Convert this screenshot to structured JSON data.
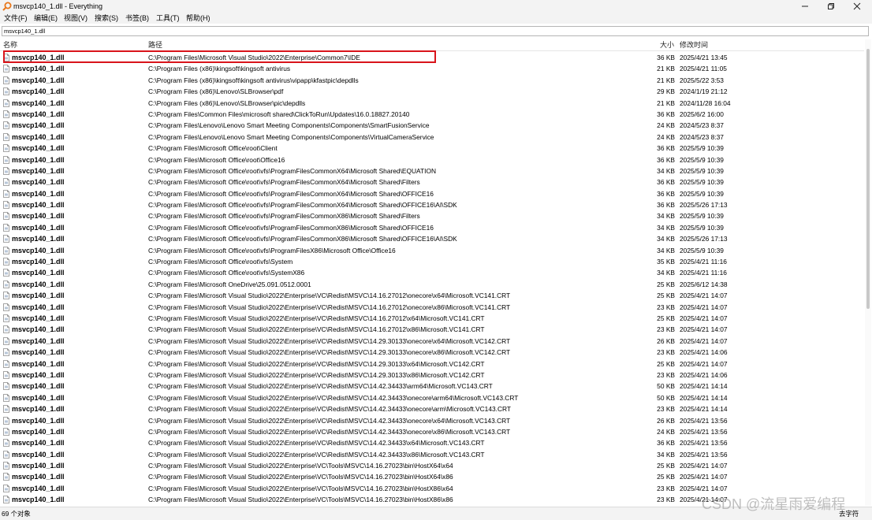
{
  "window": {
    "title": "msvcp140_1.dll - Everything"
  },
  "menu": [
    "文件(F)",
    "编辑(E)",
    "视图(V)",
    "搜索(S)",
    "书签(B)",
    "工具(T)",
    "帮助(H)"
  ],
  "search": {
    "value": "msvcp140_1.dll"
  },
  "columns": {
    "name": "名称",
    "path": "路径",
    "size": "大小",
    "modified": "修改时间"
  },
  "rows": [
    {
      "name": "msvcp140_1.dll",
      "path": "C:\\Program Files\\Microsoft Visual Studio\\2022\\Enterprise\\Common7\\IDE",
      "size": "36 KB",
      "modified": "2025/4/21 13:45"
    },
    {
      "name": "msvcp140_1.dll",
      "path": "C:\\Program Files (x86)\\kingsoft\\kingsoft antivirus",
      "size": "21 KB",
      "modified": "2025/4/21 11:05"
    },
    {
      "name": "msvcp140_1.dll",
      "path": "C:\\Program Files (x86)\\kingsoft\\kingsoft antivirus\\vipapp\\kfastpic\\depdlls",
      "size": "21 KB",
      "modified": "2025/5/22 3:53"
    },
    {
      "name": "msvcp140_1.dll",
      "path": "C:\\Program Files (x86)\\Lenovo\\SLBrowser\\pdf",
      "size": "29 KB",
      "modified": "2024/1/19 21:12"
    },
    {
      "name": "msvcp140_1.dll",
      "path": "C:\\Program Files (x86)\\Lenovo\\SLBrowser\\pic\\depdlls",
      "size": "21 KB",
      "modified": "2024/11/28 16:04"
    },
    {
      "name": "msvcp140_1.dll",
      "path": "C:\\Program Files\\Common Files\\microsoft shared\\ClickToRun\\Updates\\16.0.18827.20140",
      "size": "36 KB",
      "modified": "2025/6/2 16:00"
    },
    {
      "name": "msvcp140_1.dll",
      "path": "C:\\Program Files\\Lenovo\\Lenovo Smart Meeting Components\\Components\\SmartFusionService",
      "size": "24 KB",
      "modified": "2024/5/23 8:37"
    },
    {
      "name": "msvcp140_1.dll",
      "path": "C:\\Program Files\\Lenovo\\Lenovo Smart Meeting Components\\Components\\VirtualCameraService",
      "size": "24 KB",
      "modified": "2024/5/23 8:37"
    },
    {
      "name": "msvcp140_1.dll",
      "path": "C:\\Program Files\\Microsoft Office\\root\\Client",
      "size": "36 KB",
      "modified": "2025/5/9 10:39"
    },
    {
      "name": "msvcp140_1.dll",
      "path": "C:\\Program Files\\Microsoft Office\\root\\Office16",
      "size": "36 KB",
      "modified": "2025/5/9 10:39"
    },
    {
      "name": "msvcp140_1.dll",
      "path": "C:\\Program Files\\Microsoft Office\\root\\vfs\\ProgramFilesCommonX64\\Microsoft Shared\\EQUATION",
      "size": "34 KB",
      "modified": "2025/5/9 10:39"
    },
    {
      "name": "msvcp140_1.dll",
      "path": "C:\\Program Files\\Microsoft Office\\root\\vfs\\ProgramFilesCommonX64\\Microsoft Shared\\Filters",
      "size": "36 KB",
      "modified": "2025/5/9 10:39"
    },
    {
      "name": "msvcp140_1.dll",
      "path": "C:\\Program Files\\Microsoft Office\\root\\vfs\\ProgramFilesCommonX64\\Microsoft Shared\\OFFICE16",
      "size": "36 KB",
      "modified": "2025/5/9 10:39"
    },
    {
      "name": "msvcp140_1.dll",
      "path": "C:\\Program Files\\Microsoft Office\\root\\vfs\\ProgramFilesCommonX64\\Microsoft Shared\\OFFICE16\\AI\\SDK",
      "size": "36 KB",
      "modified": "2025/5/26 17:13"
    },
    {
      "name": "msvcp140_1.dll",
      "path": "C:\\Program Files\\Microsoft Office\\root\\vfs\\ProgramFilesCommonX86\\Microsoft Shared\\Filters",
      "size": "34 KB",
      "modified": "2025/5/9 10:39"
    },
    {
      "name": "msvcp140_1.dll",
      "path": "C:\\Program Files\\Microsoft Office\\root\\vfs\\ProgramFilesCommonX86\\Microsoft Shared\\OFFICE16",
      "size": "34 KB",
      "modified": "2025/5/9 10:39"
    },
    {
      "name": "msvcp140_1.dll",
      "path": "C:\\Program Files\\Microsoft Office\\root\\vfs\\ProgramFilesCommonX86\\Microsoft Shared\\OFFICE16\\AI\\SDK",
      "size": "34 KB",
      "modified": "2025/5/26 17:13"
    },
    {
      "name": "msvcp140_1.dll",
      "path": "C:\\Program Files\\Microsoft Office\\root\\vfs\\ProgramFilesX86\\Microsoft Office\\Office16",
      "size": "34 KB",
      "modified": "2025/5/9 10:39"
    },
    {
      "name": "msvcp140_1.dll",
      "path": "C:\\Program Files\\Microsoft Office\\root\\vfs\\System",
      "size": "35 KB",
      "modified": "2025/4/21 11:16"
    },
    {
      "name": "msvcp140_1.dll",
      "path": "C:\\Program Files\\Microsoft Office\\root\\vfs\\SystemX86",
      "size": "34 KB",
      "modified": "2025/4/21 11:16"
    },
    {
      "name": "msvcp140_1.dll",
      "path": "C:\\Program Files\\Microsoft OneDrive\\25.091.0512.0001",
      "size": "25 KB",
      "modified": "2025/6/12 14:38"
    },
    {
      "name": "msvcp140_1.dll",
      "path": "C:\\Program Files\\Microsoft Visual Studio\\2022\\Enterprise\\VC\\Redist\\MSVC\\14.16.27012\\onecore\\x64\\Microsoft.VC141.CRT",
      "size": "25 KB",
      "modified": "2025/4/21 14:07"
    },
    {
      "name": "msvcp140_1.dll",
      "path": "C:\\Program Files\\Microsoft Visual Studio\\2022\\Enterprise\\VC\\Redist\\MSVC\\14.16.27012\\onecore\\x86\\Microsoft.VC141.CRT",
      "size": "23 KB",
      "modified": "2025/4/21 14:07"
    },
    {
      "name": "msvcp140_1.dll",
      "path": "C:\\Program Files\\Microsoft Visual Studio\\2022\\Enterprise\\VC\\Redist\\MSVC\\14.16.27012\\x64\\Microsoft.VC141.CRT",
      "size": "25 KB",
      "modified": "2025/4/21 14:07"
    },
    {
      "name": "msvcp140_1.dll",
      "path": "C:\\Program Files\\Microsoft Visual Studio\\2022\\Enterprise\\VC\\Redist\\MSVC\\14.16.27012\\x86\\Microsoft.VC141.CRT",
      "size": "23 KB",
      "modified": "2025/4/21 14:07"
    },
    {
      "name": "msvcp140_1.dll",
      "path": "C:\\Program Files\\Microsoft Visual Studio\\2022\\Enterprise\\VC\\Redist\\MSVC\\14.29.30133\\onecore\\x64\\Microsoft.VC142.CRT",
      "size": "26 KB",
      "modified": "2025/4/21 14:07"
    },
    {
      "name": "msvcp140_1.dll",
      "path": "C:\\Program Files\\Microsoft Visual Studio\\2022\\Enterprise\\VC\\Redist\\MSVC\\14.29.30133\\onecore\\x86\\Microsoft.VC142.CRT",
      "size": "23 KB",
      "modified": "2025/4/21 14:06"
    },
    {
      "name": "msvcp140_1.dll",
      "path": "C:\\Program Files\\Microsoft Visual Studio\\2022\\Enterprise\\VC\\Redist\\MSVC\\14.29.30133\\x64\\Microsoft.VC142.CRT",
      "size": "25 KB",
      "modified": "2025/4/21 14:07"
    },
    {
      "name": "msvcp140_1.dll",
      "path": "C:\\Program Files\\Microsoft Visual Studio\\2022\\Enterprise\\VC\\Redist\\MSVC\\14.29.30133\\x86\\Microsoft.VC142.CRT",
      "size": "23 KB",
      "modified": "2025/4/21 14:06"
    },
    {
      "name": "msvcp140_1.dll",
      "path": "C:\\Program Files\\Microsoft Visual Studio\\2022\\Enterprise\\VC\\Redist\\MSVC\\14.42.34433\\arm64\\Microsoft.VC143.CRT",
      "size": "50 KB",
      "modified": "2025/4/21 14:14"
    },
    {
      "name": "msvcp140_1.dll",
      "path": "C:\\Program Files\\Microsoft Visual Studio\\2022\\Enterprise\\VC\\Redist\\MSVC\\14.42.34433\\onecore\\arm64\\Microsoft.VC143.CRT",
      "size": "50 KB",
      "modified": "2025/4/21 14:14"
    },
    {
      "name": "msvcp140_1.dll",
      "path": "C:\\Program Files\\Microsoft Visual Studio\\2022\\Enterprise\\VC\\Redist\\MSVC\\14.42.34433\\onecore\\arm\\Microsoft.VC143.CRT",
      "size": "23 KB",
      "modified": "2025/4/21 14:14"
    },
    {
      "name": "msvcp140_1.dll",
      "path": "C:\\Program Files\\Microsoft Visual Studio\\2022\\Enterprise\\VC\\Redist\\MSVC\\14.42.34433\\onecore\\x64\\Microsoft.VC143.CRT",
      "size": "26 KB",
      "modified": "2025/4/21 13:56"
    },
    {
      "name": "msvcp140_1.dll",
      "path": "C:\\Program Files\\Microsoft Visual Studio\\2022\\Enterprise\\VC\\Redist\\MSVC\\14.42.34433\\onecore\\x86\\Microsoft.VC143.CRT",
      "size": "24 KB",
      "modified": "2025/4/21 13:56"
    },
    {
      "name": "msvcp140_1.dll",
      "path": "C:\\Program Files\\Microsoft Visual Studio\\2022\\Enterprise\\VC\\Redist\\MSVC\\14.42.34433\\x64\\Microsoft.VC143.CRT",
      "size": "36 KB",
      "modified": "2025/4/21 13:56"
    },
    {
      "name": "msvcp140_1.dll",
      "path": "C:\\Program Files\\Microsoft Visual Studio\\2022\\Enterprise\\VC\\Redist\\MSVC\\14.42.34433\\x86\\Microsoft.VC143.CRT",
      "size": "34 KB",
      "modified": "2025/4/21 13:56"
    },
    {
      "name": "msvcp140_1.dll",
      "path": "C:\\Program Files\\Microsoft Visual Studio\\2022\\Enterprise\\VC\\Tools\\MSVC\\14.16.27023\\bin\\HostX64\\x64",
      "size": "25 KB",
      "modified": "2025/4/21 14:07"
    },
    {
      "name": "msvcp140_1.dll",
      "path": "C:\\Program Files\\Microsoft Visual Studio\\2022\\Enterprise\\VC\\Tools\\MSVC\\14.16.27023\\bin\\HostX64\\x86",
      "size": "25 KB",
      "modified": "2025/4/21 14:07"
    },
    {
      "name": "msvcp140_1.dll",
      "path": "C:\\Program Files\\Microsoft Visual Studio\\2022\\Enterprise\\VC\\Tools\\MSVC\\14.16.27023\\bin\\HostX86\\x64",
      "size": "23 KB",
      "modified": "2025/4/21 14:07"
    },
    {
      "name": "msvcp140_1.dll",
      "path": "C:\\Program Files\\Microsoft Visual Studio\\2022\\Enterprise\\VC\\Tools\\MSVC\\14.16.27023\\bin\\HostX86\\x86",
      "size": "23 KB",
      "modified": "2025/4/21 14:07"
    }
  ],
  "status": {
    "count": "69 个对象",
    "right": "去字符"
  },
  "watermark": "CSDN @流星雨爱编程",
  "colors": {
    "highlight": "#d9141b",
    "titlebar": "#f3f3f3",
    "app_icon": "#e8771a"
  }
}
